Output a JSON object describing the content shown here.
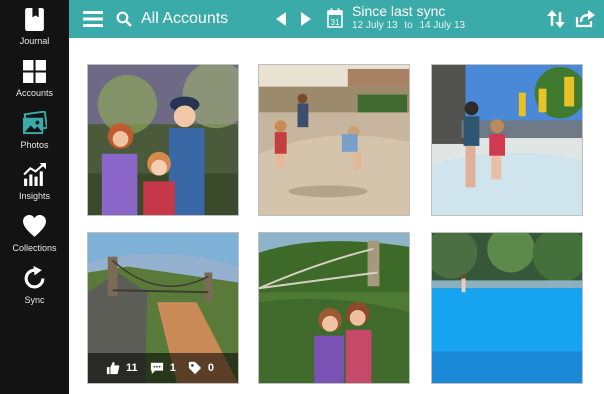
{
  "sidebar": {
    "items": [
      {
        "label": "Journal",
        "icon": "journal-icon"
      },
      {
        "label": "Accounts",
        "icon": "accounts-grid-icon"
      },
      {
        "label": "Photos",
        "icon": "photos-icon"
      },
      {
        "label": "Insights",
        "icon": "insights-chart-icon"
      },
      {
        "label": "Collections",
        "icon": "heart-icon"
      },
      {
        "label": "Sync",
        "icon": "sync-icon"
      }
    ],
    "active_color": "#3aaba8"
  },
  "header": {
    "title": "All Accounts",
    "sync_title": "Since last sync",
    "date_from": "12 July 13",
    "date_sep": "to",
    "date_to": "14 July 13",
    "calendar_day": "31",
    "accent": "#3aaba8"
  },
  "photos": [
    {
      "label": "photo-1"
    },
    {
      "label": "photo-2"
    },
    {
      "label": "photo-3"
    },
    {
      "label": "photo-4",
      "likes": "11",
      "comments": "1",
      "tags": "0"
    },
    {
      "label": "photo-5"
    },
    {
      "label": "photo-6"
    }
  ]
}
